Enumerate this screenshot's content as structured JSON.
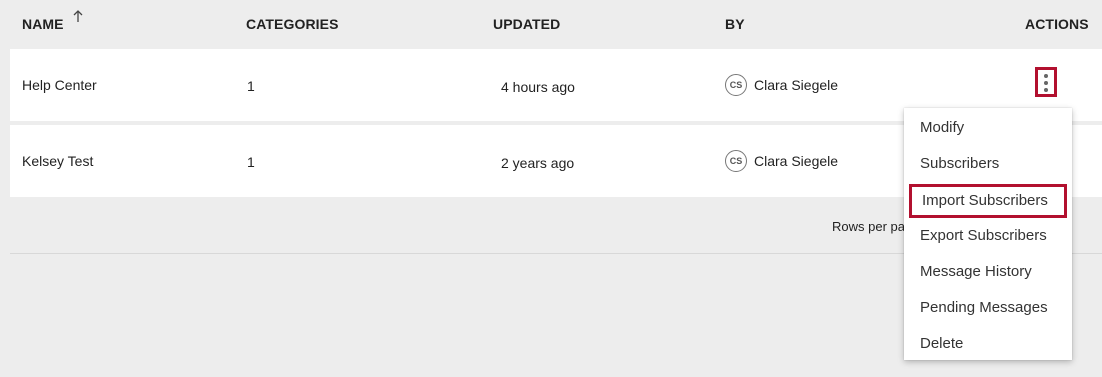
{
  "table": {
    "headers": {
      "name": "NAME",
      "categories": "CATEGORIES",
      "updated": "UPDATED",
      "by": "BY",
      "actions": "ACTIONS"
    },
    "sort_icon": "arrow-up-icon",
    "rows": [
      {
        "name": "Help Center",
        "categories": "1",
        "updated": "4 hours ago",
        "by_initials": "CS",
        "by_name": "Clara Siegele"
      },
      {
        "name": "Kelsey Test",
        "categories": "1",
        "updated": "2 years ago",
        "by_initials": "CS",
        "by_name": "Clara Siegele"
      }
    ]
  },
  "footer": {
    "rows_per_page_label": "Rows per pa"
  },
  "actions_menu": {
    "icon": "kebab-vertical-icon",
    "items": [
      {
        "label": "Modify"
      },
      {
        "label": "Subscribers"
      },
      {
        "label": "Import Subscribers"
      },
      {
        "label": "Export Subscribers"
      },
      {
        "label": "Message History"
      },
      {
        "label": "Pending Messages"
      },
      {
        "label": "Delete"
      }
    ]
  },
  "colors": {
    "accent": "#b2102f",
    "background": "#ededed",
    "row": "#ffffff"
  }
}
